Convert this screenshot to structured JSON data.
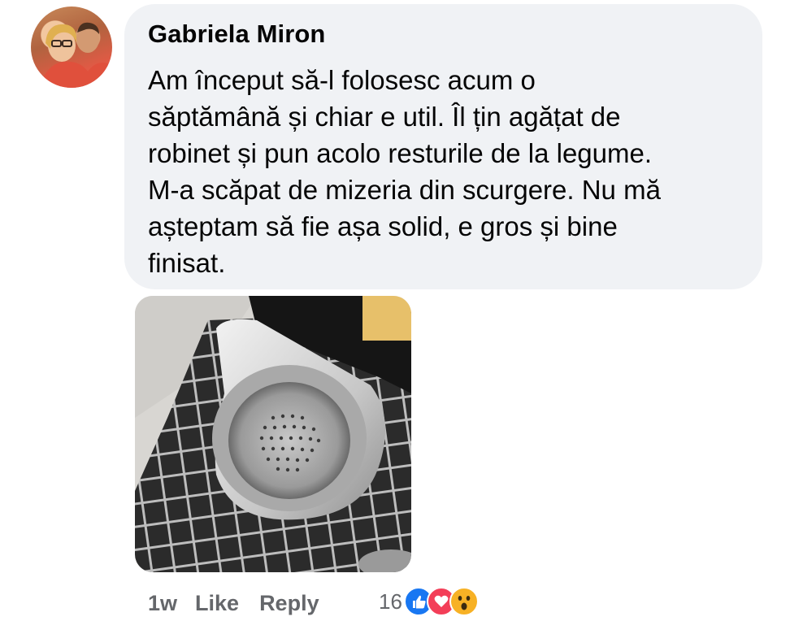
{
  "comment": {
    "author": "Gabriela Miron",
    "lines": [
      "Am început să-l folosesc acum o",
      "săptămână și chiar e util. Îl țin agățat de",
      "robinet și pun acolo resturile de la legume.",
      "M-a scăpat de mizeria din scurgere. Nu mă",
      "așteptam să fie așa solid, e gros și bine",
      "finisat."
    ],
    "time": "1w",
    "like_label": "Like",
    "reply_label": "Reply",
    "reaction_count": "16",
    "reaction_icons": [
      "like-icon",
      "love-icon",
      "wow-icon"
    ]
  },
  "colors": {
    "bubble": "#f0f2f5",
    "meta_text": "#65676b",
    "like": "#1877f2",
    "love": "#f33e58",
    "wow": "#f7b125"
  }
}
